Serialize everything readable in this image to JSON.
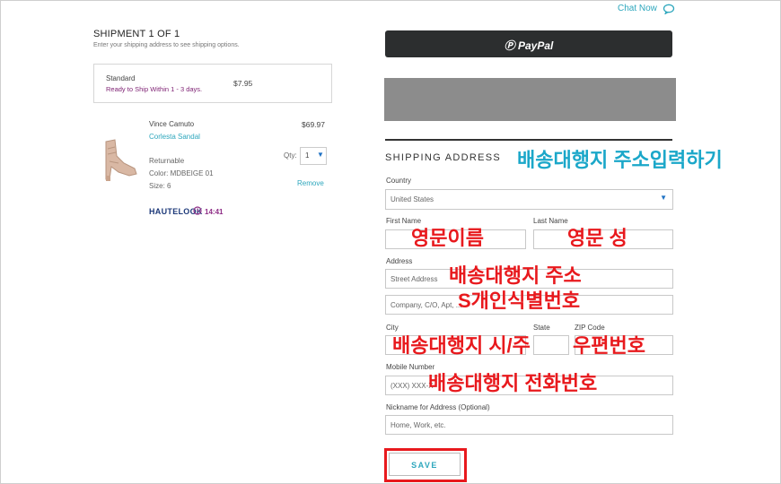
{
  "chat": {
    "label": "Chat Now"
  },
  "shipment": {
    "title": "SHIPMENT 1 OF 1",
    "subtitle": "Enter your shipping address to see shipping options.",
    "method": {
      "name": "Standard",
      "ready": "Ready to Ship Within 1 - 3 days.",
      "price": "$7.95"
    }
  },
  "item": {
    "brand": "Vince Camuto",
    "name": "Corlesta Sandal",
    "price": "$69.97",
    "returnable": "Returnable",
    "color": "Color: MDBEIGE 01",
    "size": "Size: 6",
    "qty_label": "Qty:",
    "qty_value": "1",
    "remove": "Remove",
    "logo": "HAUTELOOK",
    "timer": "14:41"
  },
  "payment": {
    "paypal_label": "PayPal"
  },
  "form": {
    "heading": "SHIPPING ADDRESS",
    "country_label": "Country",
    "country_value": "United States",
    "first_name_label": "First Name",
    "last_name_label": "Last Name",
    "address_label": "Address",
    "street_placeholder": "Street Address",
    "company_placeholder": "Company, C/O, Apt, ...",
    "city_label": "City",
    "state_label": "State",
    "zip_label": "ZIP Code",
    "mobile_label": "Mobile Number",
    "mobile_placeholder": "(XXX) XXX-X",
    "nickname_label": "Nickname for Address (Optional)",
    "nickname_placeholder": "Home, Work, etc.",
    "save_label": "SAVE"
  },
  "annotations": {
    "shipping_heading": "배송대행지 주소입력하기",
    "first_name": "영문이름",
    "last_name": "영문 성",
    "address": "배송대행지 주소",
    "customs_id": "S개인식별번호",
    "city_state": "배송대행지 시/주",
    "zip": "우편번호",
    "phone": "배송대행지 전화번호"
  },
  "colors": {
    "accent": "#2ea7bd",
    "purple": "#7d1f72",
    "annotation_red": "#e8191d",
    "annotation_blue": "#1ba7c9",
    "paypal_bg": "#2c2e2f"
  }
}
